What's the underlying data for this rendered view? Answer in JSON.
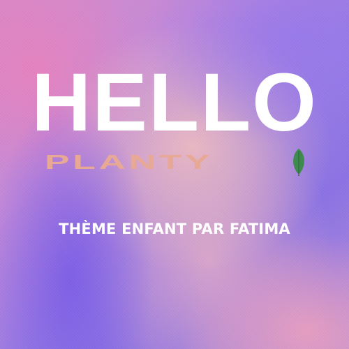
{
  "headline": "HELLO",
  "brand": {
    "name": "PLANTY",
    "color": "#e7a996",
    "leaf_color": "#3f8a4e",
    "icon": "leaf-icon"
  },
  "tagline": "THÈME ENFANT PAR FATIMA",
  "colors": {
    "background_pink": "#d689c7",
    "background_violet": "#8b72e3",
    "text": "#ffffff"
  }
}
